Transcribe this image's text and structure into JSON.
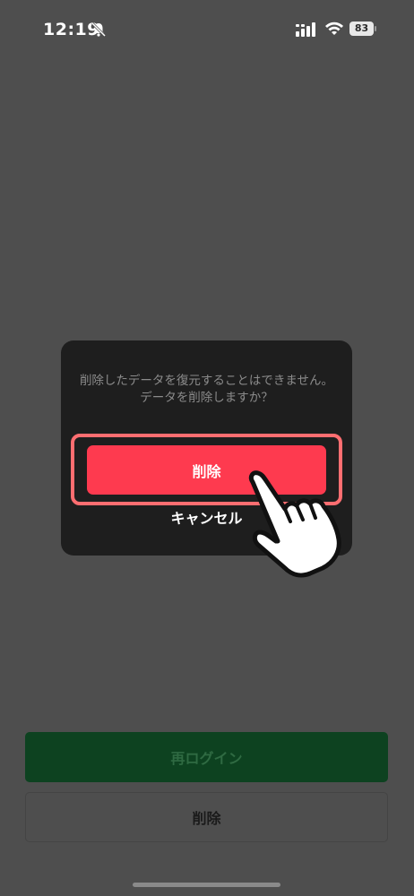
{
  "status_bar": {
    "time": "12:19",
    "battery": "83",
    "icons": [
      "bell-slash-icon",
      "signal-icon",
      "wifi-icon",
      "battery-icon"
    ]
  },
  "dialog": {
    "message": "削除したデータを復元することはできません。\nデータを削除しますか？",
    "delete_label": "削除",
    "cancel_label": "キャンセル",
    "highlight_color": "#ff6e71",
    "delete_color": "#fe3a4f"
  },
  "footer": {
    "relogin_label": "再ログイン",
    "delete_label": "削除",
    "relogin_color": "#0d4220"
  },
  "pointer": {
    "icon": "pointing-hand-icon"
  }
}
